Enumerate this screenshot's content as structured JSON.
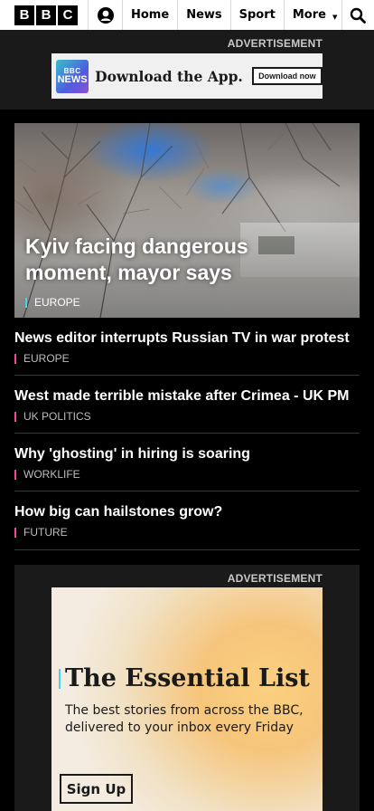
{
  "nav": {
    "logo_letters": [
      "B",
      "B",
      "C"
    ],
    "account_icon": "account-icon",
    "links": [
      "Home",
      "News",
      "Sport"
    ],
    "more_label": "More",
    "more_icon": "caret-down-icon",
    "search_icon": "search-icon"
  },
  "top_ad": {
    "label": "ADVERTISEMENT",
    "logo_line1": "BBC",
    "logo_line2": "NEWS",
    "text": "Download the App.",
    "button": "Download now"
  },
  "hero": {
    "title": "Kyiv facing dangerous moment, mayor says",
    "tag": "EUROPE",
    "tag_color": "#49d2f0"
  },
  "stories": [
    {
      "title": "News editor interrupts Russian TV in war protest",
      "tag": "EUROPE"
    },
    {
      "title": "West made terrible mistake after Crimea - UK PM",
      "tag": "UK POLITICS"
    },
    {
      "title": "Why 'ghosting' in hiring is soaring",
      "tag": "WORKLIFE"
    },
    {
      "title": "How big can hailstones grow?",
      "tag": "FUTURE"
    }
  ],
  "story_tag_color": "#f54997",
  "newsletter_ad": {
    "label": "ADVERTISEMENT",
    "title": "The Essential List",
    "text": "The best stories from across the BBC, delivered to your inbox every Friday",
    "button": "Sign Up"
  }
}
